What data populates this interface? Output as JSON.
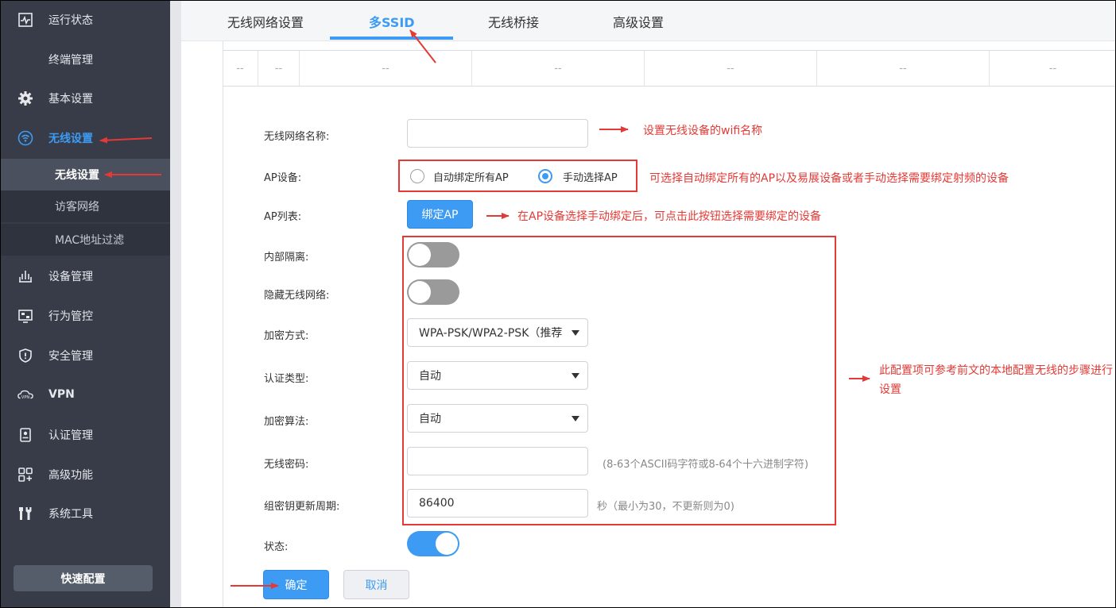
{
  "sidebar": {
    "items": [
      {
        "label": "运行状态",
        "icon": "chart-pulse-icon"
      },
      {
        "label": "终端管理",
        "icon": ""
      },
      {
        "label": "基本设置",
        "icon": "gear-icon"
      },
      {
        "label": "无线设置",
        "icon": "wifi-icon"
      },
      {
        "label": "设备管理",
        "icon": "router-icon"
      },
      {
        "label": "行为管控",
        "icon": "monitor-icon"
      },
      {
        "label": "安全管理",
        "icon": "shield-icon"
      },
      {
        "label": "VPN",
        "icon": "vpn-cloud-icon"
      },
      {
        "label": "认证管理",
        "icon": "badge-icon"
      },
      {
        "label": "高级功能",
        "icon": "apps-grid-icon"
      },
      {
        "label": "系统工具",
        "icon": "tools-icon"
      }
    ],
    "subitems": [
      {
        "label": "无线设置"
      },
      {
        "label": "访客网络"
      },
      {
        "label": "MAC地址过滤"
      }
    ],
    "quick_config": "快速配置"
  },
  "tabs": [
    {
      "label": "无线网络设置"
    },
    {
      "label": "多SSID"
    },
    {
      "label": "无线桥接"
    },
    {
      "label": "高级设置"
    }
  ],
  "table": {
    "cells": [
      "--",
      "--",
      "--",
      "--",
      "--",
      "--",
      "--"
    ]
  },
  "form": {
    "ssid_label": "无线网络名称:",
    "ssid_value": "",
    "ap_device_label": "AP设备:",
    "ap_auto_label": "自动绑定所有AP",
    "ap_manual_label": "手动选择AP",
    "ap_list_label": "AP列表:",
    "bind_ap_button": "绑定AP",
    "isolation_label": "内部隔离:",
    "hide_ssid_label": "隐藏无线网络:",
    "encryption_label": "加密方式:",
    "encryption_value": "WPA-PSK/WPA2-PSK（推荐）",
    "auth_type_label": "认证类型:",
    "auth_type_value": "自动",
    "algorithm_label": "加密算法:",
    "algorithm_value": "自动",
    "password_label": "无线密码:",
    "password_value": "",
    "password_hint": "(8-63个ASCII码字符或8-64个十六进制字符)",
    "rekey_label": "组密钥更新周期:",
    "rekey_value": "86400",
    "rekey_hint": "秒（最小为30，不更新则为0)",
    "status_label": "状态:",
    "ok_button": "确定",
    "cancel_button": "取消"
  },
  "annotations": {
    "ssid_note": "设置无线设备的wifi名称",
    "ap_note": "可选择自动绑定所有的AP以及易展设备或者手动选择需要绑定射频的设备",
    "bind_note": "在AP设备选择手动绑定后，可点击此按钮选择需要绑定的设备",
    "config_note": "此配置项可参考前文的本地配置无线的步骤进行设置"
  },
  "colors": {
    "accent": "#3d9bf4",
    "annotation": "#e53935",
    "sidebar_bg": "#373c48"
  }
}
